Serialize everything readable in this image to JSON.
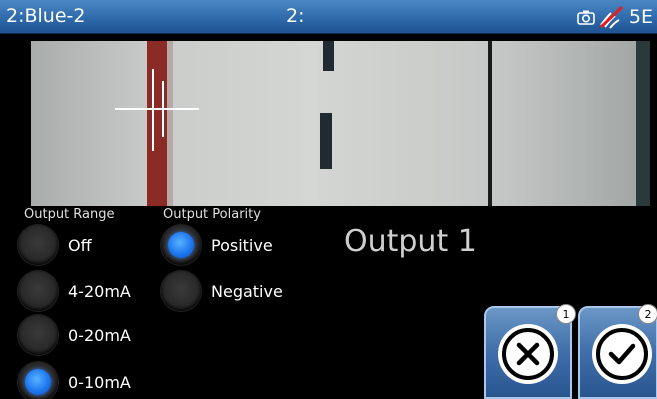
{
  "titlebar": {
    "left": "2:Blue-2",
    "center": "2:",
    "right_code": "5E",
    "icons": [
      "camera-icon",
      "no-signal-icon"
    ]
  },
  "camera": {
    "overlay": "crosshair-icon"
  },
  "output_range": {
    "label": "Output Range",
    "options": [
      {
        "label": "Off",
        "selected": false
      },
      {
        "label": "4-20mA",
        "selected": false
      },
      {
        "label": "0-20mA",
        "selected": false
      },
      {
        "label": "0-10mA",
        "selected": true
      }
    ]
  },
  "output_polarity": {
    "label": "Output Polarity",
    "options": [
      {
        "label": "Positive",
        "selected": true
      },
      {
        "label": "Negative",
        "selected": false
      }
    ]
  },
  "output_title": "Output 1",
  "actions": {
    "cancel": {
      "icon": "close-icon",
      "badge": "1"
    },
    "confirm": {
      "icon": "check-icon",
      "badge": "2"
    }
  },
  "colors": {
    "titlebar": "#2f6aab",
    "radio_on": "#1e78f0",
    "button": "#3f6ea8"
  }
}
